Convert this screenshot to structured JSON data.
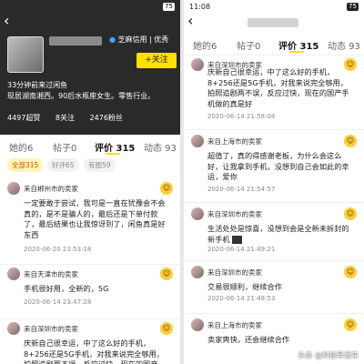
{
  "left": {
    "status": {
      "time": "",
      "battery": "75"
    },
    "header": {
      "credit_label": "芝麻信用 | 优秀",
      "follow_button": "+关注",
      "active_status": "33分钟前来过闲鱼",
      "bio": "现居湖南湘西。90后水瓶座女生。零售行业。",
      "stats": [
        "4497超赞",
        "8关注",
        "2476粉丝"
      ]
    },
    "tabs": [
      {
        "label": "她的6",
        "active": false
      },
      {
        "label": "帖子0",
        "active": false
      },
      {
        "label": "评价 315",
        "active": true
      },
      {
        "label": "动态 93",
        "active": false
      }
    ],
    "chips": [
      {
        "label": "全部315",
        "active": true
      },
      {
        "label": "好评65",
        "active": false
      },
      {
        "label": "有图59",
        "active": false
      }
    ],
    "reviews": [
      {
        "from": "来自郴州市的卖家",
        "text": "一定要敢于尝试，我可是一直在犹豫会不会真的，是不是骗人的，最后还是下单付款了，最后结果也让我惊讶到了，闲鱼真是好东西",
        "time": "2020-06-20 23:53:18"
      },
      {
        "from": "来自天津市的卖家",
        "text": "手机很好用，全新的，5G",
        "time": "2020-06-14 23:47:28"
      },
      {
        "from": "来自深圳市的卖家",
        "text": "庆新自己很幸运，中了这么好的手机，8+256还是5G手机，对我来说完全够用，拍照追剧两不误，反应过快，现在的国产",
        "time": ""
      }
    ]
  },
  "right": {
    "status": {
      "time": "11:08",
      "battery": "75"
    },
    "tabs": [
      {
        "label": "她的6",
        "active": false
      },
      {
        "label": "帖子0",
        "active": false
      },
      {
        "label": "评价 315",
        "active": true
      },
      {
        "label": "动态 93",
        "active": false
      }
    ],
    "reviews": [
      {
        "from": "来自深圳市的卖家",
        "text": "庆新自己很幸运，中了这么好的手机，8+256还是5G手机，对我来说完全够用，拍照追剧两不误，反应过快，现在的国产手机做的真是好",
        "time": "2020-06-14 21:58:04"
      },
      {
        "from": "来自上海市的卖家",
        "text": "超值了，真的得感谢老板，为什么会这么好，让我拿到手机，没想到自己会如此的幸运，爱你",
        "time": "2020-06-14 21:54:57"
      },
      {
        "from": "来自深圳市的卖家",
        "text": "生活处处是惊喜，没想到会是全新未拆封的新手机",
        "time": "2020-06-14 21:49:21"
      },
      {
        "from": "来自深圳市的卖家",
        "text": "交易很顺利，继续合作",
        "time": "2020-06-14 21:48:53"
      },
      {
        "from": "来自上海市的卖家",
        "text": "卖家爽快，还会继续合作",
        "time": ""
      }
    ],
    "watermark": "头条 @科技早发车"
  }
}
